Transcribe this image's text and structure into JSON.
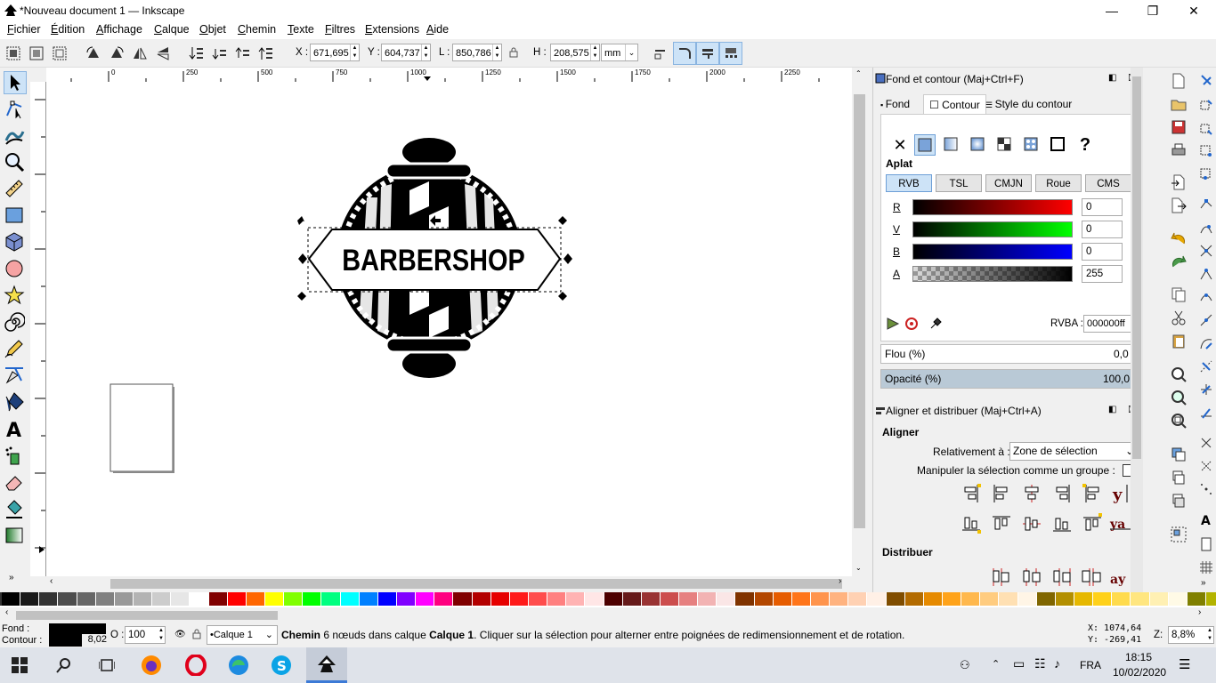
{
  "window": {
    "title": "*Nouveau document 1 — Inkscape",
    "minimize": "—",
    "maximize": "❐",
    "close": "✕"
  },
  "menu": [
    "Fichier",
    "Édition",
    "Affichage",
    "Calque",
    "Objet",
    "Chemin",
    "Texte",
    "Filtres",
    "Extensions",
    "Aide"
  ],
  "toolbar": {
    "x_label": "X :",
    "x_value": "671,695",
    "y_label": "Y :",
    "y_value": "604,737",
    "w_label": "L :",
    "w_value": "850,786",
    "h_label": "H :",
    "h_value": "208,575",
    "unit": "mm"
  },
  "ruler": {
    "top_ticks": [
      "0",
      "250",
      "500",
      "750",
      "1000",
      "1250",
      "1500",
      "1750",
      "2000",
      "2250"
    ]
  },
  "canvas": {
    "logo_text": "BARBERSHOP"
  },
  "fill_stroke": {
    "title": "Fond et contour (Maj+Ctrl+F)",
    "tabs": [
      "Fond",
      "Contour",
      "Style du contour"
    ],
    "active_tab": "Contour",
    "section": "Aplat",
    "color_modes": [
      "RVB",
      "TSL",
      "CMJN",
      "Roue",
      "CMS"
    ],
    "active_mode": "RVB",
    "channels": [
      {
        "label": "R",
        "value": "0"
      },
      {
        "label": "V",
        "value": "0"
      },
      {
        "label": "B",
        "value": "0"
      },
      {
        "label": "A",
        "value": "255"
      }
    ],
    "rgba_label": "RVBA :",
    "rgba_value": "000000ff",
    "blur_label": "Flou (%)",
    "blur_value": "0,0",
    "opacity_label": "Opacité (%)",
    "opacity_value": "100,0"
  },
  "align": {
    "title": "Aligner et distribuer (Maj+Ctrl+A)",
    "section_align": "Aligner",
    "relative_label": "Relativement à :",
    "relative_value": "Zone de sélection",
    "group_label": "Manipuler la sélection comme un groupe :",
    "section_distribute": "Distribuer"
  },
  "status": {
    "fill_label": "Fond :",
    "stroke_label": "Contour :",
    "stroke_width": "8,02",
    "opacity_label": "O :",
    "opacity_value": "100",
    "layer": "•Calque 1",
    "message_bold": "Chemin",
    "message_part1": " 6 nœuds dans calque ",
    "message_layer": "Calque 1",
    "message_part2": ". Cliquer sur la sélection pour alterner entre poignées de redimensionnement et de rotation.",
    "cursor_x": "X: 1074,64",
    "cursor_y": "Y: -269,41",
    "zoom_label": "Z:",
    "zoom_value": "8,8%"
  },
  "taskbar": {
    "lang": "FRA",
    "time": "18:15",
    "date": "10/02/2020"
  },
  "palette": [
    "#000000",
    "#1a1a1a",
    "#333333",
    "#4d4d4d",
    "#666666",
    "#808080",
    "#999999",
    "#b3b3b3",
    "#cccccc",
    "#e6e6e6",
    "#ffffff",
    "#800000",
    "#ff0000",
    "#ff6600",
    "#ffff00",
    "#80ff00",
    "#00ff00",
    "#00ff80",
    "#00ffff",
    "#0080ff",
    "#0000ff",
    "#8000ff",
    "#ff00ff",
    "#ff0080",
    "#800000",
    "#b30000",
    "#e60000",
    "#ff1a1a",
    "#ff4d4d",
    "#ff8080",
    "#ffb3b3",
    "#ffe6e6",
    "#4d0000",
    "#661a1a",
    "#993333",
    "#cc4d4d",
    "#e68080",
    "#f2b3b3",
    "#fae6e6",
    "#803300",
    "#b34700",
    "#e65c00",
    "#ff751a",
    "#ff944d",
    "#ffb380",
    "#ffd1b3",
    "#fff0e6",
    "#804d00",
    "#b36b00",
    "#e68a00",
    "#ffa31a",
    "#ffb84d",
    "#ffcc80",
    "#ffe0b3",
    "#fff5e6",
    "#806600",
    "#b38f00",
    "#e6b800",
    "#ffd11a",
    "#ffdb4d",
    "#ffe680",
    "#fff0b3",
    "#fffae6",
    "#808000",
    "#b3b300",
    "#e6e600",
    "#ffff1a"
  ]
}
